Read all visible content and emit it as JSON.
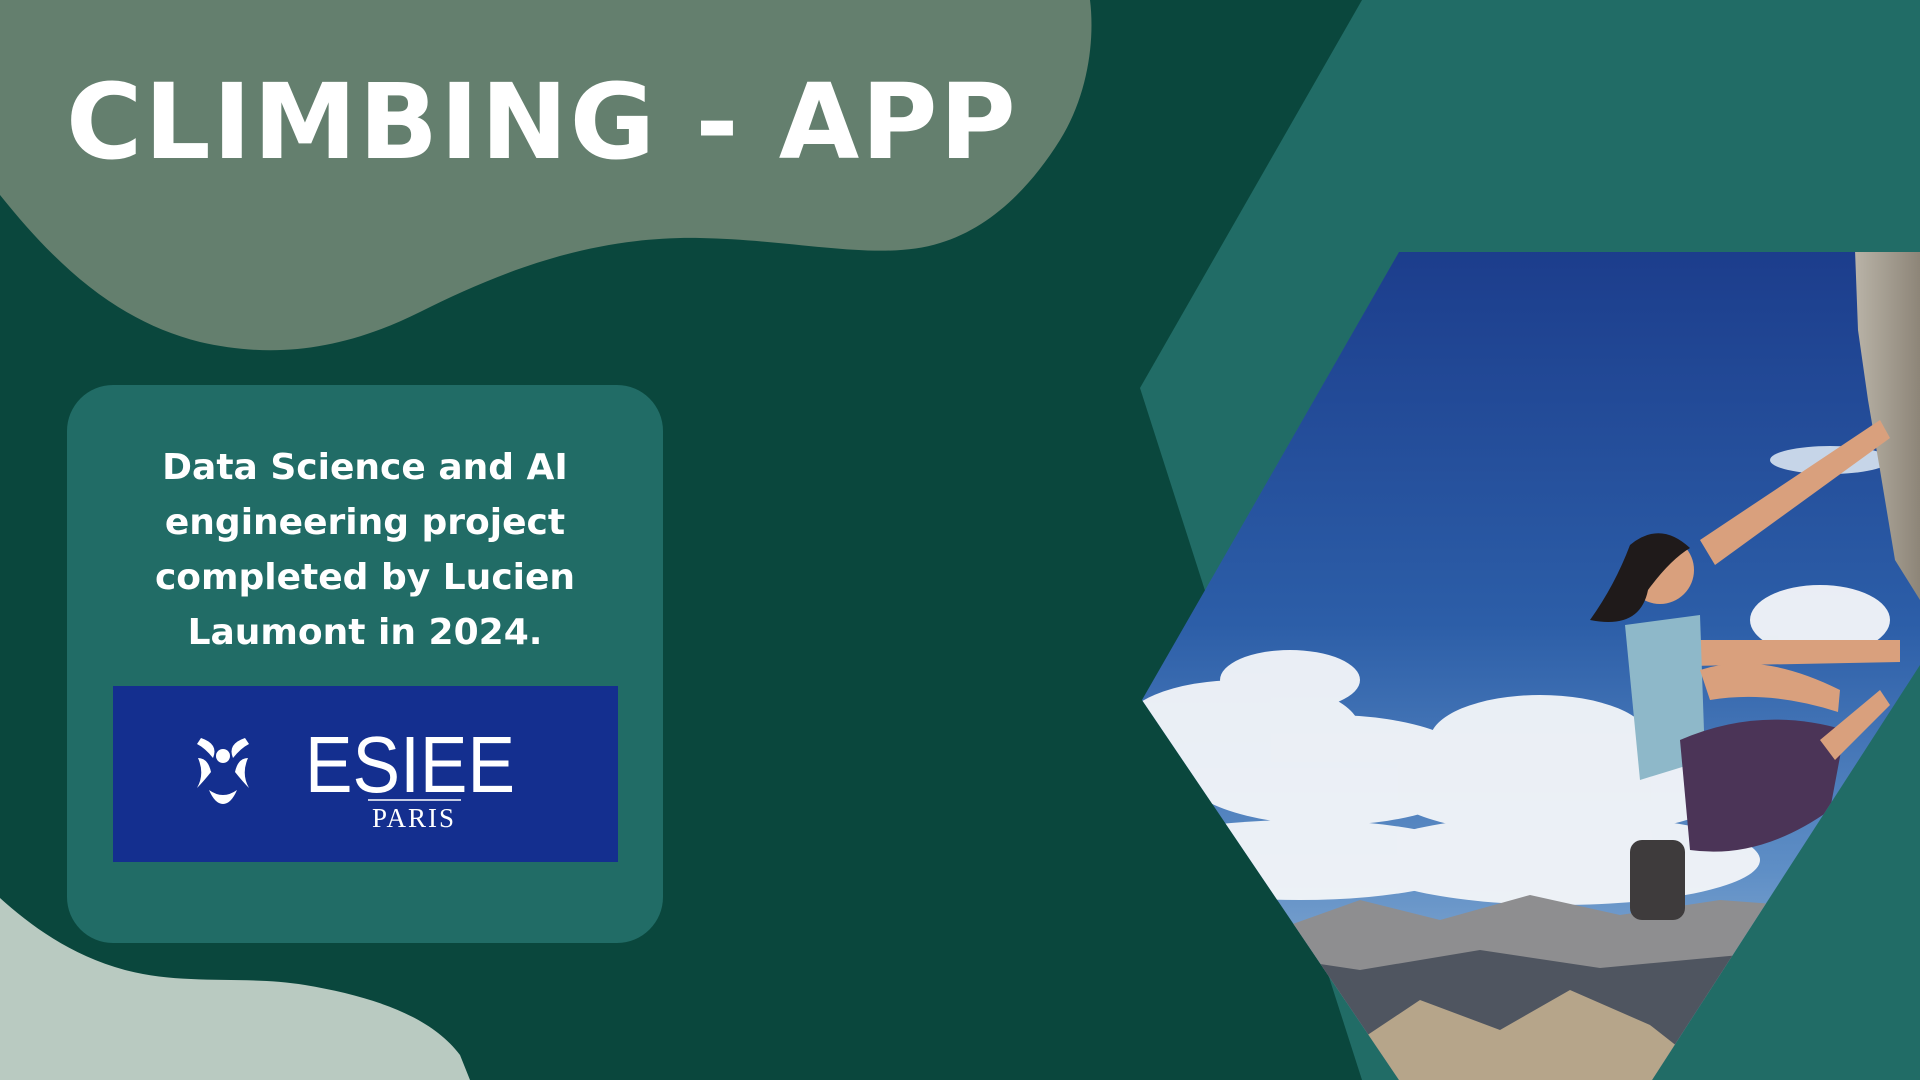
{
  "slide": {
    "title": "CLIMBING - APP",
    "description": "Data Science and AI engineering project completed by Lucien Laumont in 2024."
  },
  "logo": {
    "name": "ESIEE",
    "city": "PARIS",
    "background": "#142f8f"
  },
  "colors": {
    "background": "#0a473d",
    "blob_top": "#647f6e",
    "blob_bottom": "#b9cac1",
    "card": "#216c66",
    "hexagon": "#216c66"
  },
  "photo": {
    "subject": "woman bouldering on a rock face against a blue sky with clouds and mountains"
  }
}
